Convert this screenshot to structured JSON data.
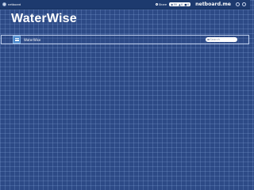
{
  "topbar": {
    "username": "netboard",
    "share_label": "Share",
    "stats": [
      {
        "icon": "eye-icon",
        "value": "55"
      },
      {
        "icon": "thumbs-up-icon",
        "value": "0"
      },
      {
        "icon": "comment-icon",
        "value": "0"
      }
    ],
    "brand": "netboard.me"
  },
  "page": {
    "title": "WaterWise"
  },
  "board_bar": {
    "name": "WaterWise",
    "search_placeholder": "Search"
  },
  "colors": {
    "background": "#2d4a86",
    "topbar": "#1d3a6e",
    "menu_button": "#4a86c9"
  }
}
